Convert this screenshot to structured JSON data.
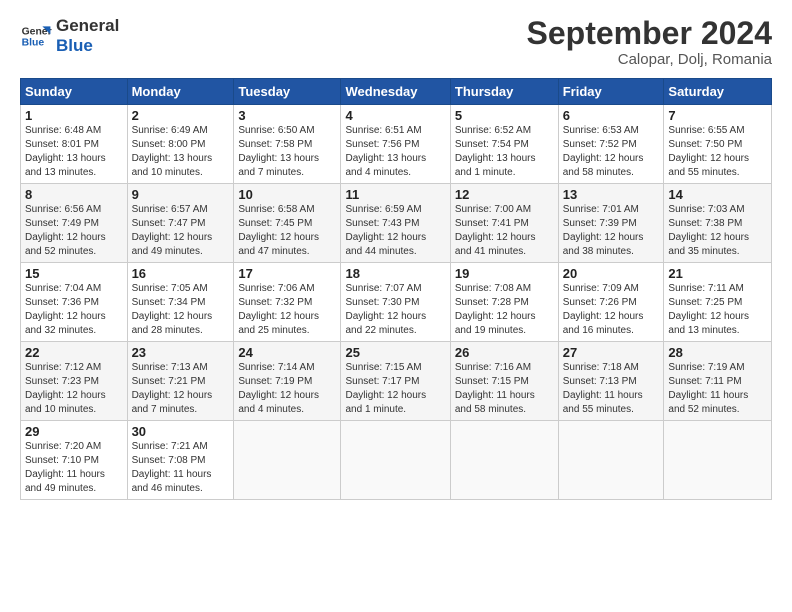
{
  "logo": {
    "line1": "General",
    "line2": "Blue"
  },
  "title": "September 2024",
  "location": "Calopar, Dolj, Romania",
  "days_of_week": [
    "Sunday",
    "Monday",
    "Tuesday",
    "Wednesday",
    "Thursday",
    "Friday",
    "Saturday"
  ],
  "weeks": [
    [
      {
        "day": "1",
        "info": "Sunrise: 6:48 AM\nSunset: 8:01 PM\nDaylight: 13 hours\nand 13 minutes."
      },
      {
        "day": "2",
        "info": "Sunrise: 6:49 AM\nSunset: 8:00 PM\nDaylight: 13 hours\nand 10 minutes."
      },
      {
        "day": "3",
        "info": "Sunrise: 6:50 AM\nSunset: 7:58 PM\nDaylight: 13 hours\nand 7 minutes."
      },
      {
        "day": "4",
        "info": "Sunrise: 6:51 AM\nSunset: 7:56 PM\nDaylight: 13 hours\nand 4 minutes."
      },
      {
        "day": "5",
        "info": "Sunrise: 6:52 AM\nSunset: 7:54 PM\nDaylight: 13 hours\nand 1 minute."
      },
      {
        "day": "6",
        "info": "Sunrise: 6:53 AM\nSunset: 7:52 PM\nDaylight: 12 hours\nand 58 minutes."
      },
      {
        "day": "7",
        "info": "Sunrise: 6:55 AM\nSunset: 7:50 PM\nDaylight: 12 hours\nand 55 minutes."
      }
    ],
    [
      {
        "day": "8",
        "info": "Sunrise: 6:56 AM\nSunset: 7:49 PM\nDaylight: 12 hours\nand 52 minutes."
      },
      {
        "day": "9",
        "info": "Sunrise: 6:57 AM\nSunset: 7:47 PM\nDaylight: 12 hours\nand 49 minutes."
      },
      {
        "day": "10",
        "info": "Sunrise: 6:58 AM\nSunset: 7:45 PM\nDaylight: 12 hours\nand 47 minutes."
      },
      {
        "day": "11",
        "info": "Sunrise: 6:59 AM\nSunset: 7:43 PM\nDaylight: 12 hours\nand 44 minutes."
      },
      {
        "day": "12",
        "info": "Sunrise: 7:00 AM\nSunset: 7:41 PM\nDaylight: 12 hours\nand 41 minutes."
      },
      {
        "day": "13",
        "info": "Sunrise: 7:01 AM\nSunset: 7:39 PM\nDaylight: 12 hours\nand 38 minutes."
      },
      {
        "day": "14",
        "info": "Sunrise: 7:03 AM\nSunset: 7:38 PM\nDaylight: 12 hours\nand 35 minutes."
      }
    ],
    [
      {
        "day": "15",
        "info": "Sunrise: 7:04 AM\nSunset: 7:36 PM\nDaylight: 12 hours\nand 32 minutes."
      },
      {
        "day": "16",
        "info": "Sunrise: 7:05 AM\nSunset: 7:34 PM\nDaylight: 12 hours\nand 28 minutes."
      },
      {
        "day": "17",
        "info": "Sunrise: 7:06 AM\nSunset: 7:32 PM\nDaylight: 12 hours\nand 25 minutes."
      },
      {
        "day": "18",
        "info": "Sunrise: 7:07 AM\nSunset: 7:30 PM\nDaylight: 12 hours\nand 22 minutes."
      },
      {
        "day": "19",
        "info": "Sunrise: 7:08 AM\nSunset: 7:28 PM\nDaylight: 12 hours\nand 19 minutes."
      },
      {
        "day": "20",
        "info": "Sunrise: 7:09 AM\nSunset: 7:26 PM\nDaylight: 12 hours\nand 16 minutes."
      },
      {
        "day": "21",
        "info": "Sunrise: 7:11 AM\nSunset: 7:25 PM\nDaylight: 12 hours\nand 13 minutes."
      }
    ],
    [
      {
        "day": "22",
        "info": "Sunrise: 7:12 AM\nSunset: 7:23 PM\nDaylight: 12 hours\nand 10 minutes."
      },
      {
        "day": "23",
        "info": "Sunrise: 7:13 AM\nSunset: 7:21 PM\nDaylight: 12 hours\nand 7 minutes."
      },
      {
        "day": "24",
        "info": "Sunrise: 7:14 AM\nSunset: 7:19 PM\nDaylight: 12 hours\nand 4 minutes."
      },
      {
        "day": "25",
        "info": "Sunrise: 7:15 AM\nSunset: 7:17 PM\nDaylight: 12 hours\nand 1 minute."
      },
      {
        "day": "26",
        "info": "Sunrise: 7:16 AM\nSunset: 7:15 PM\nDaylight: 11 hours\nand 58 minutes."
      },
      {
        "day": "27",
        "info": "Sunrise: 7:18 AM\nSunset: 7:13 PM\nDaylight: 11 hours\nand 55 minutes."
      },
      {
        "day": "28",
        "info": "Sunrise: 7:19 AM\nSunset: 7:11 PM\nDaylight: 11 hours\nand 52 minutes."
      }
    ],
    [
      {
        "day": "29",
        "info": "Sunrise: 7:20 AM\nSunset: 7:10 PM\nDaylight: 11 hours\nand 49 minutes."
      },
      {
        "day": "30",
        "info": "Sunrise: 7:21 AM\nSunset: 7:08 PM\nDaylight: 11 hours\nand 46 minutes."
      },
      {
        "day": "",
        "info": ""
      },
      {
        "day": "",
        "info": ""
      },
      {
        "day": "",
        "info": ""
      },
      {
        "day": "",
        "info": ""
      },
      {
        "day": "",
        "info": ""
      }
    ]
  ]
}
